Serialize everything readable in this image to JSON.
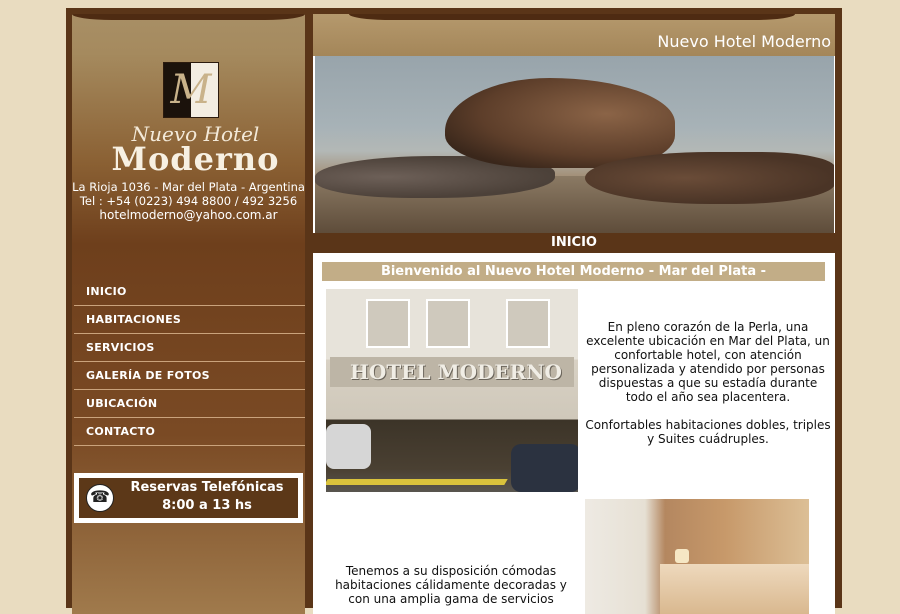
{
  "sidebar": {
    "logo": {
      "letter": "M",
      "line1": "Nuevo Hotel",
      "line2": "Moderno"
    },
    "contact": {
      "address": "La Rioja 1036 - Mar del Plata - Argentina",
      "phone": "Tel : +54 (0223) 494 8800 /  492 3256",
      "email": "hotelmoderno@yahoo.com.ar"
    },
    "menu": [
      {
        "label": "INICIO"
      },
      {
        "label": "HABITACIONES"
      },
      {
        "label": "SERVICIOS"
      },
      {
        "label": "GALERÍA DE FOTOS"
      },
      {
        "label": "UBICACIÓN"
      },
      {
        "label": "CONTACTO"
      }
    ],
    "reservas": {
      "title": "Reservas Telefónicas",
      "hours": "8:00 a 13 hs",
      "icon": "phone-icon"
    }
  },
  "main": {
    "site_title": "Nuevo Hotel Moderno",
    "section_title": "INICIO",
    "welcome": "Bienvenido al Nuevo Hotel Moderno - Mar del Plata -",
    "hotel_sign": "HOTEL MODERNO",
    "intro_paragraph_1": "En pleno corazón de la Perla, una excelente ubicación en Mar del Plata, un confortable hotel, con atención personalizada y atendido por personas dispuestas a que su estadía durante todo el año sea placentera.",
    "intro_paragraph_2": "Confortables habitaciones dobles, triples y Suites cuádruples.",
    "rooms_paragraph": "Tenemos a su disposición cómodas habitaciones cálidamente decoradas y con una amplia gama de servicios"
  },
  "colors": {
    "page_bg": "#e9dcc0",
    "frame_brown": "#5a3518",
    "header_tan": "#b5996d",
    "welcome_bar": "#c2ad87"
  }
}
